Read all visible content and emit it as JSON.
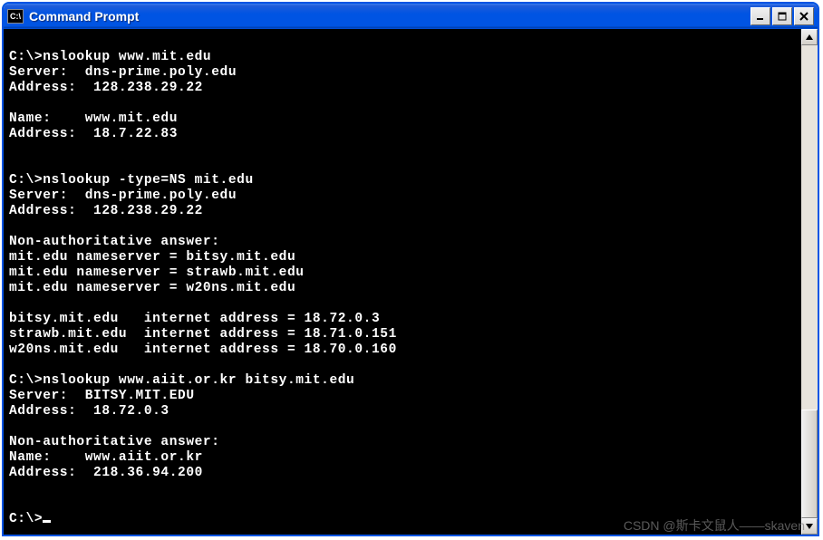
{
  "window": {
    "title": "Command Prompt",
    "icon_text": "C:\\"
  },
  "terminal": {
    "lines": [
      "",
      "C:\\>nslookup www.mit.edu",
      "Server:  dns-prime.poly.edu",
      "Address:  128.238.29.22",
      "",
      "Name:    www.mit.edu",
      "Address:  18.7.22.83",
      "",
      "",
      "C:\\>nslookup -type=NS mit.edu",
      "Server:  dns-prime.poly.edu",
      "Address:  128.238.29.22",
      "",
      "Non-authoritative answer:",
      "mit.edu nameserver = bitsy.mit.edu",
      "mit.edu nameserver = strawb.mit.edu",
      "mit.edu nameserver = w20ns.mit.edu",
      "",
      "bitsy.mit.edu   internet address = 18.72.0.3",
      "strawb.mit.edu  internet address = 18.71.0.151",
      "w20ns.mit.edu   internet address = 18.70.0.160",
      "",
      "C:\\>nslookup www.aiit.or.kr bitsy.mit.edu",
      "Server:  BITSY.MIT.EDU",
      "Address:  18.72.0.3",
      "",
      "Non-authoritative answer:",
      "Name:    www.aiit.or.kr",
      "Address:  218.36.94.200",
      "",
      "",
      "C:\\>"
    ]
  },
  "watermark": "CSDN @斯卡文鼠人——skaven"
}
